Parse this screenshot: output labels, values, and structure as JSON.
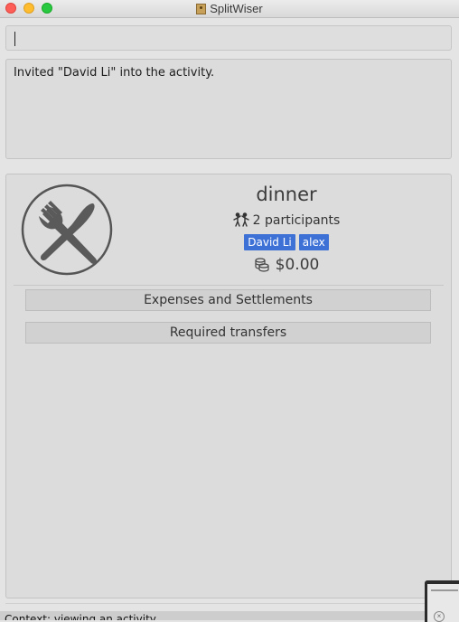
{
  "window": {
    "title": "SplitWiser"
  },
  "command_box": {
    "value": ""
  },
  "result": {
    "message": "Invited \"David Li\" into the activity."
  },
  "activity": {
    "name": "dinner",
    "participants_label": "2 participants",
    "participants": [
      "David Li",
      "alex"
    ],
    "amount": "$0.00",
    "icon": "fork-knife-icon"
  },
  "buttons": {
    "expenses": "Expenses and Settlements",
    "transfers": "Required transfers"
  },
  "status": {
    "text": "Context: viewing an activity"
  },
  "colors": {
    "tag": "#3e71d6",
    "background": "#e4e4e4"
  }
}
